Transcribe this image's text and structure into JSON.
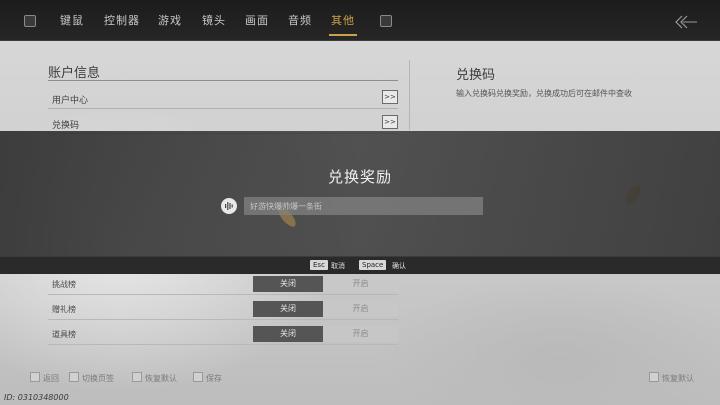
{
  "nav": {
    "tabs": [
      {
        "label": "键鼠"
      },
      {
        "label": "控制器"
      },
      {
        "label": "游戏"
      },
      {
        "label": "镜头"
      },
      {
        "label": "画面"
      },
      {
        "label": "音频"
      },
      {
        "label": "其他"
      }
    ],
    "active_tab": "其他"
  },
  "account": {
    "title": "账户信息",
    "items": [
      {
        "label": "用户中心",
        "action": ">>"
      },
      {
        "label": "兑换码",
        "action": ">>"
      }
    ]
  },
  "redeem_panel": {
    "title": "兑换码",
    "description": "输入兑换码兑换奖励，兑换成功后可在邮件中查收"
  },
  "modal": {
    "title": "兑换奖励",
    "input_placeholder": "好游快爆帅爆一条街",
    "voice_icon": "voice-input-icon",
    "footer": [
      {
        "key": "Esc",
        "label": "取消"
      },
      {
        "key": "Space",
        "label": "确认"
      }
    ]
  },
  "toggles": [
    {
      "label": "挑战榜",
      "off": "关闭",
      "on": "开启"
    },
    {
      "label": "赠礼榜",
      "off": "关闭",
      "on": "开启"
    },
    {
      "label": "道具榜",
      "off": "关闭",
      "on": "开启"
    }
  ],
  "bottom_hints": [
    {
      "label": "返回"
    },
    {
      "label": "切换页签"
    },
    {
      "label": "恢复默认"
    },
    {
      "label": "保存"
    },
    {
      "label": "恢复默认"
    }
  ],
  "uid": "ID: 0310348000",
  "colors": {
    "accent": "#c9a24a",
    "topbar": "#1c1c1c"
  }
}
